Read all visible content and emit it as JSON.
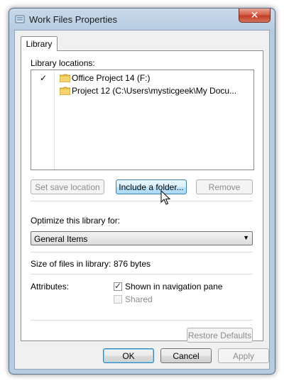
{
  "window": {
    "title": "Work Files Properties",
    "close_glyph": "✕"
  },
  "tabs": [
    {
      "label": "Library"
    }
  ],
  "library_locations": {
    "label": "Library locations:",
    "items": [
      {
        "checkmark": "✓",
        "text": "Office Project 14 (F:)",
        "icon": "folder-icon"
      },
      {
        "checkmark": "",
        "text": "Project 12 (C:\\Users\\mysticgeek\\My Docu...",
        "icon": "folder-icon"
      }
    ]
  },
  "buttons": {
    "set_save_location": "Set save location",
    "include_folder": "Include a folder...",
    "remove": "Remove",
    "restore_defaults": "Restore Defaults",
    "ok": "OK",
    "cancel": "Cancel",
    "apply": "Apply"
  },
  "optimize": {
    "label": "Optimize this library for:",
    "selected": "General Items"
  },
  "size": {
    "label": "Size of files in library:",
    "value": "876 bytes"
  },
  "attributes": {
    "label": "Attributes:",
    "shown_in_nav": {
      "label": "Shown in navigation pane",
      "checked": true
    },
    "shared": {
      "label": "Shared",
      "checked": false,
      "disabled": true
    }
  },
  "colors": {
    "accent": "#3c7fb1",
    "close_button": "#c13d24"
  }
}
